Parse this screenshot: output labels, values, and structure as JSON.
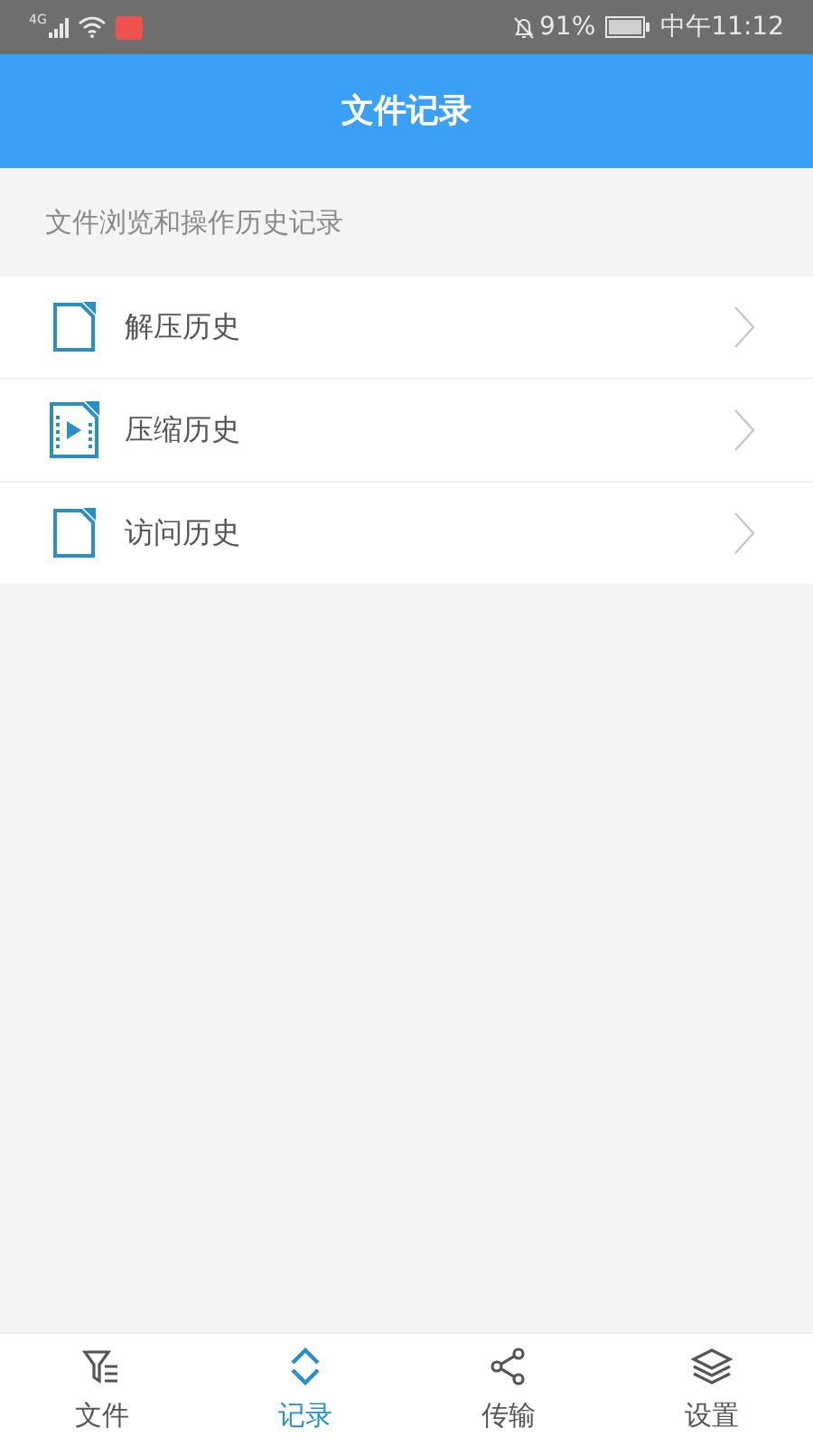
{
  "status_bar": {
    "network": "4G",
    "battery": "91%",
    "time": "中午11:12"
  },
  "header": {
    "title": "文件记录"
  },
  "section": {
    "caption": "文件浏览和操作历史记录"
  },
  "items": [
    {
      "label": "解压历史",
      "kind": "document"
    },
    {
      "label": "压缩历史",
      "kind": "video"
    },
    {
      "label": "访问历史",
      "kind": "document"
    }
  ],
  "nav": [
    {
      "label": "文件",
      "kind": "filter",
      "selected": false
    },
    {
      "label": "记录",
      "kind": "updown",
      "selected": true
    },
    {
      "label": "传输",
      "kind": "transfer",
      "selected": false
    },
    {
      "label": "设置",
      "kind": "layers",
      "selected": false
    }
  ]
}
